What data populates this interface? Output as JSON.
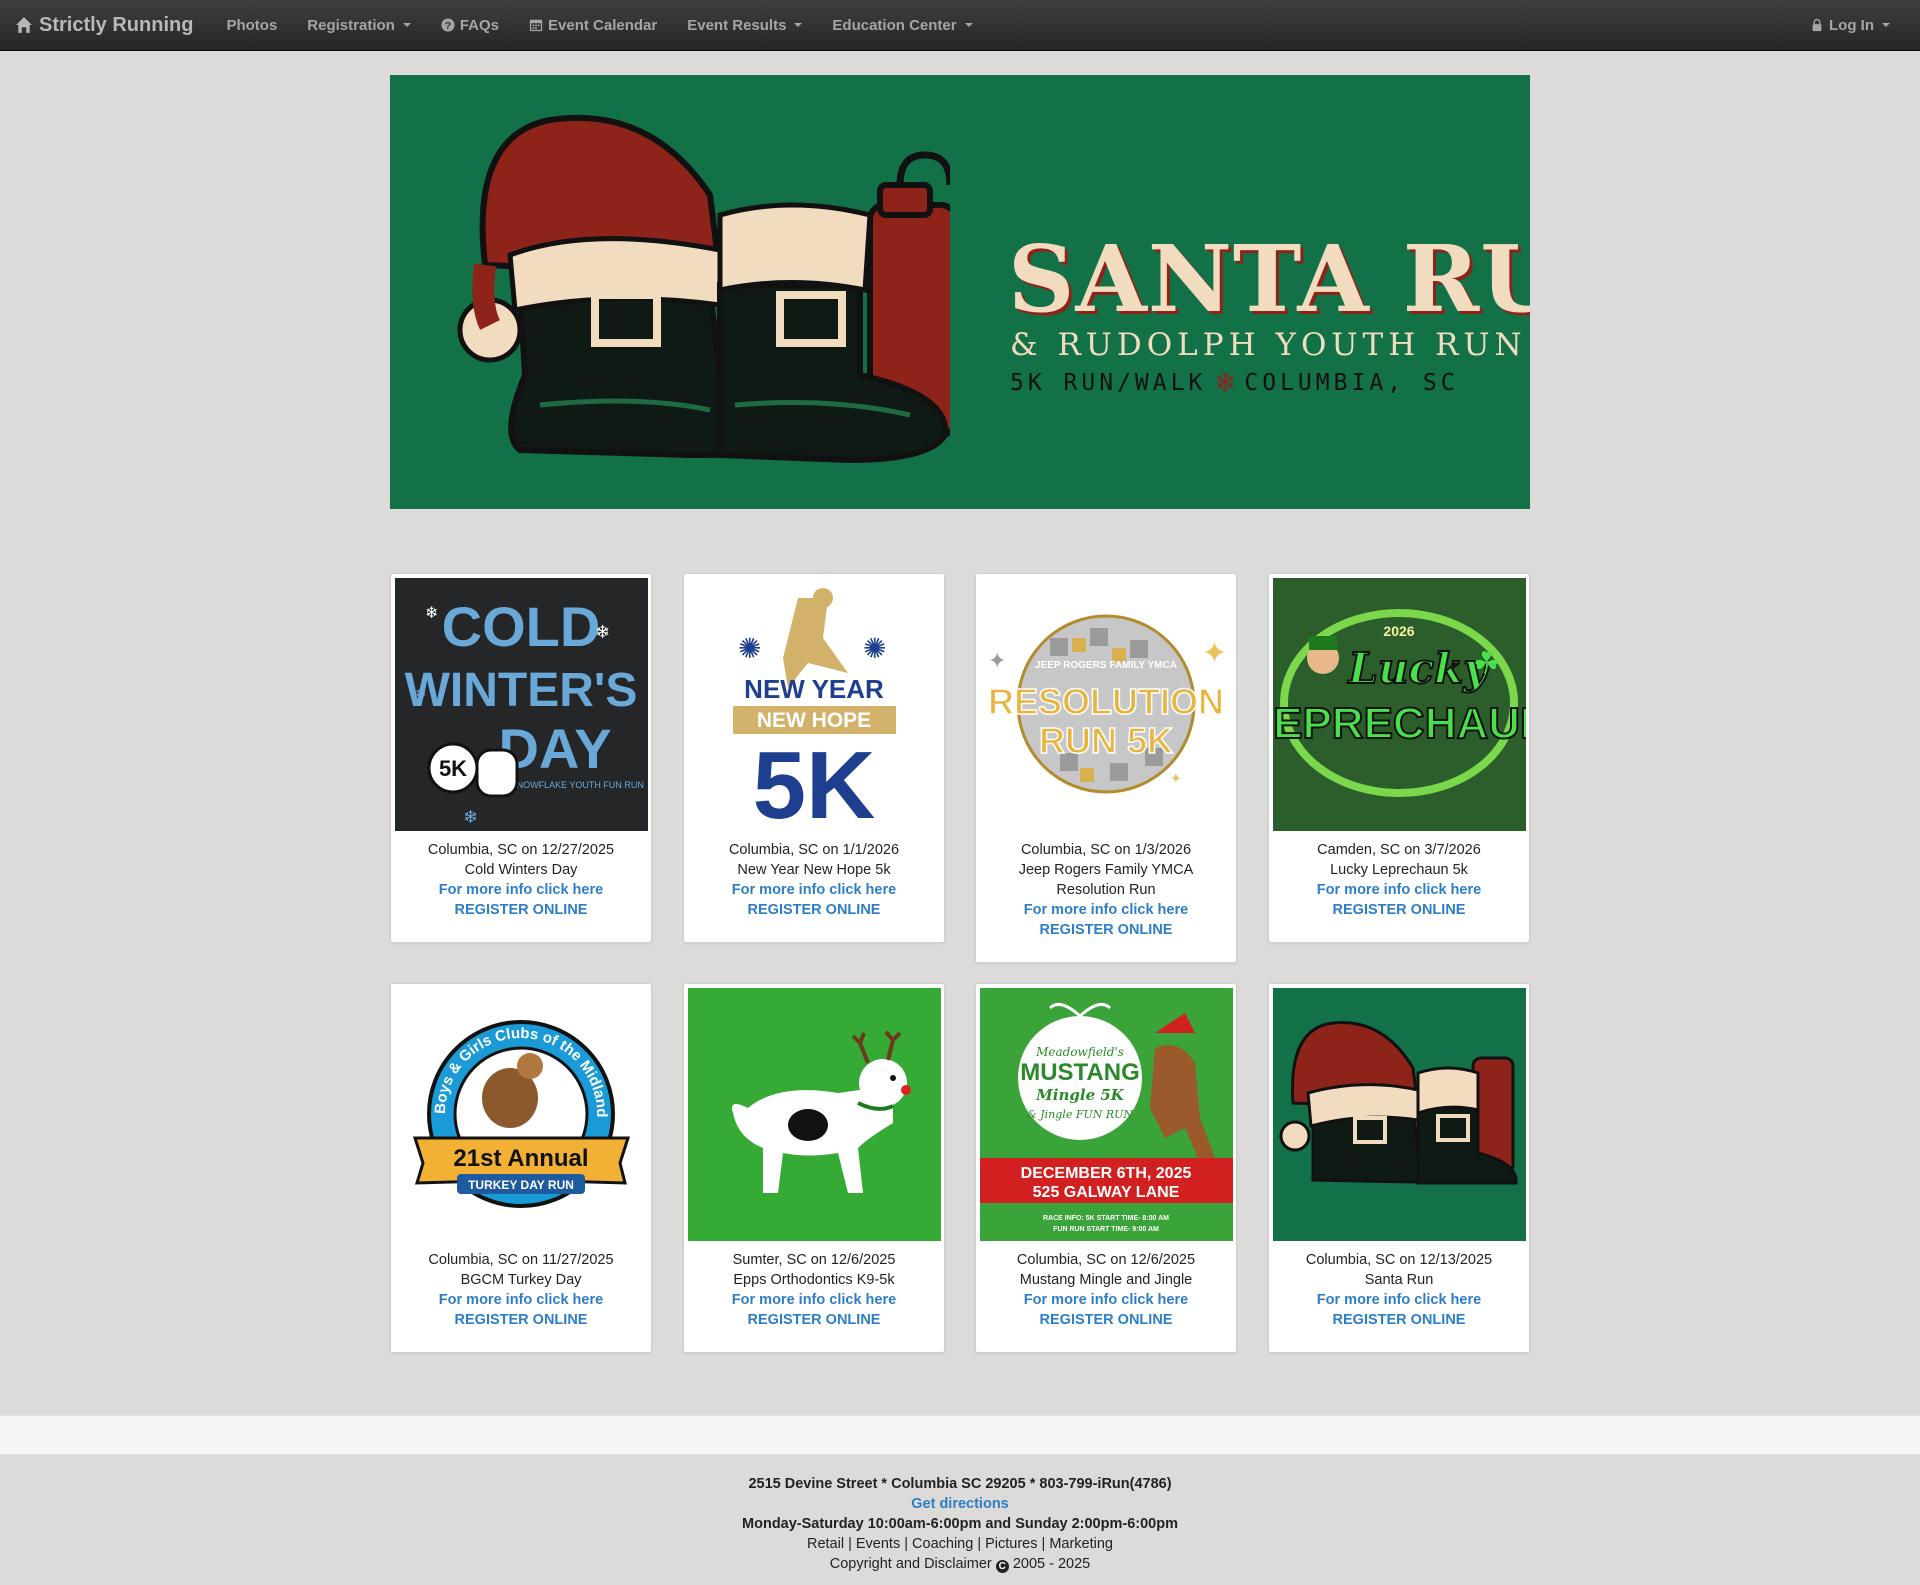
{
  "navbar": {
    "brand": "Strictly Running",
    "items": [
      {
        "label": "Photos"
      },
      {
        "label": "Registration"
      },
      {
        "label": "FAQs"
      },
      {
        "label": "Event Calendar"
      },
      {
        "label": "Event Results"
      },
      {
        "label": "Education Center"
      }
    ],
    "login": "Log In"
  },
  "hero": {
    "title": "SANTA RUN",
    "subtitle": "& RUDOLPH YOUTH RUN",
    "tagline_left": "5K RUN/WALK",
    "tagline_right": "COLUMBIA, SC"
  },
  "events": [
    {
      "location": "Columbia, SC on 12/27/2025",
      "name": "Cold Winters Day",
      "info": "For more info click here",
      "register": "REGISTER ONLINE",
      "logo": {
        "line1": "COLD",
        "line2": "WINTER'S",
        "line3": "DAY",
        "note": "& SNOWFLAKE YOUTH FUN RUN",
        "badge": "5K"
      }
    },
    {
      "location": "Columbia, SC on 1/1/2026",
      "name": "New Year New Hope 5k",
      "info": "For more info click here",
      "register": "REGISTER ONLINE",
      "logo": {
        "line1": "NEW YEAR",
        "line2": "NEW HOPE",
        "line3": "5K"
      }
    },
    {
      "location": "Columbia, SC on 1/3/2026",
      "name": "Jeep Rogers Family YMCA Resolution Run",
      "info": "For more info click here",
      "register": "REGISTER ONLINE",
      "logo": {
        "line1": "JEEP ROGERS FAMILY YMCA",
        "line2": "RESOLUTION",
        "line3": "RUN 5K"
      }
    },
    {
      "location": "Camden, SC on 3/7/2026",
      "name": "Lucky Leprechaun 5k",
      "info": "For more info click here",
      "register": "REGISTER ONLINE",
      "logo": {
        "year": "2026",
        "line1": "Lucky",
        "line2": "LEPRECHAUN"
      }
    },
    {
      "location": "Columbia, SC on 11/27/2025",
      "name": "BGCM Turkey Day",
      "info": "For more info click here",
      "register": "REGISTER ONLINE",
      "logo": {
        "ring": "Boys & Girls Clubs of the Midlands",
        "line1": "21st Annual",
        "line2": "TURKEY DAY RUN"
      }
    },
    {
      "location": "Sumter, SC on 12/6/2025",
      "name": "Epps Orthodontics K9-5k",
      "info": "For more info click here",
      "register": "REGISTER ONLINE"
    },
    {
      "location": "Columbia, SC on 12/6/2025",
      "name": "Mustang Mingle and Jingle",
      "info": "For more info click here",
      "register": "REGISTER ONLINE",
      "logo": {
        "line0": "Meadowfield's",
        "line1": "MUSTANG",
        "line2": "Mingle 5K",
        "line3": "& Jingle FUN RUN",
        "date": "DECEMBER 6TH, 2025",
        "place": "525 GALWAY LANE",
        "race1": "RACE INFO: 5K START TIME- 8:00 AM",
        "race2": "FUN RUN START TIME- 9:00 AM"
      }
    },
    {
      "location": "Columbia, SC on 12/13/2025",
      "name": "Santa Run",
      "info": "For more info click here",
      "register": "REGISTER ONLINE"
    }
  ],
  "footer": {
    "address": "2515 Devine Street * Columbia SC 29205 * 803-799-iRun(4786)",
    "directions": "Get directions",
    "hours": "Monday-Saturday 10:00am-6:00pm and Sunday 2:00pm-6:00pm",
    "links": "Retail | Events | Coaching | Pictures | Marketing",
    "copyright_label": "Copyright and Disclaimer",
    "copyright_years": "2005 - 2025"
  },
  "colors": {
    "navbar": "#2e2e2e",
    "hero_green": "#137147",
    "link_blue": "#2d7ec6",
    "page_bg": "#dcdbd9"
  }
}
